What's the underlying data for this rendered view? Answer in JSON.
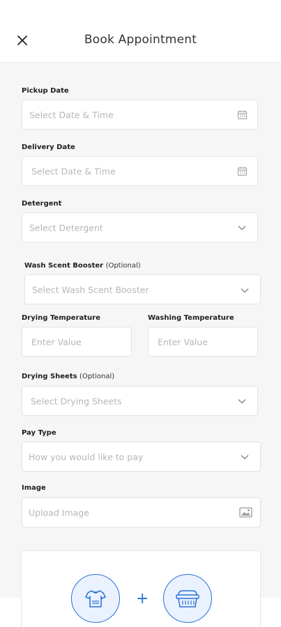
{
  "header": {
    "title": "Book Appointment"
  },
  "form": {
    "pickup": {
      "label": "Pickup Date",
      "placeholder": "Select Date & Time"
    },
    "delivery": {
      "label": "Delivery Date",
      "placeholder": "Select Date & Time"
    },
    "detergent": {
      "label": "Detergent",
      "placeholder": "Select Detergent"
    },
    "scent": {
      "label": "Wash Scent Booster",
      "optional": "(Optional)",
      "placeholder": "Select Wash Scent Booster"
    },
    "drying_temp": {
      "label": "Drying Temperature",
      "placeholder": "Enter Value"
    },
    "washing_temp": {
      "label": "Washing Temperature",
      "placeholder": "Enter Value"
    },
    "drying_sheets": {
      "label": "Drying Sheets",
      "optional": "(Optional)",
      "placeholder": "Select Drying Sheets"
    },
    "pay_type": {
      "label": "Pay Type",
      "placeholder": "How you would like to pay"
    },
    "image": {
      "label": "Image",
      "placeholder": "Upload Image"
    }
  },
  "services": {
    "plus": "+"
  },
  "colors": {
    "accent": "#2a6fd6",
    "placeholder": "#b6b6b6",
    "background": "#f6f6f6"
  },
  "icons": [
    "close-icon",
    "calendar-icon",
    "chevron-down-icon",
    "image-icon",
    "shirt-icon",
    "laundry-basket-icon"
  ]
}
